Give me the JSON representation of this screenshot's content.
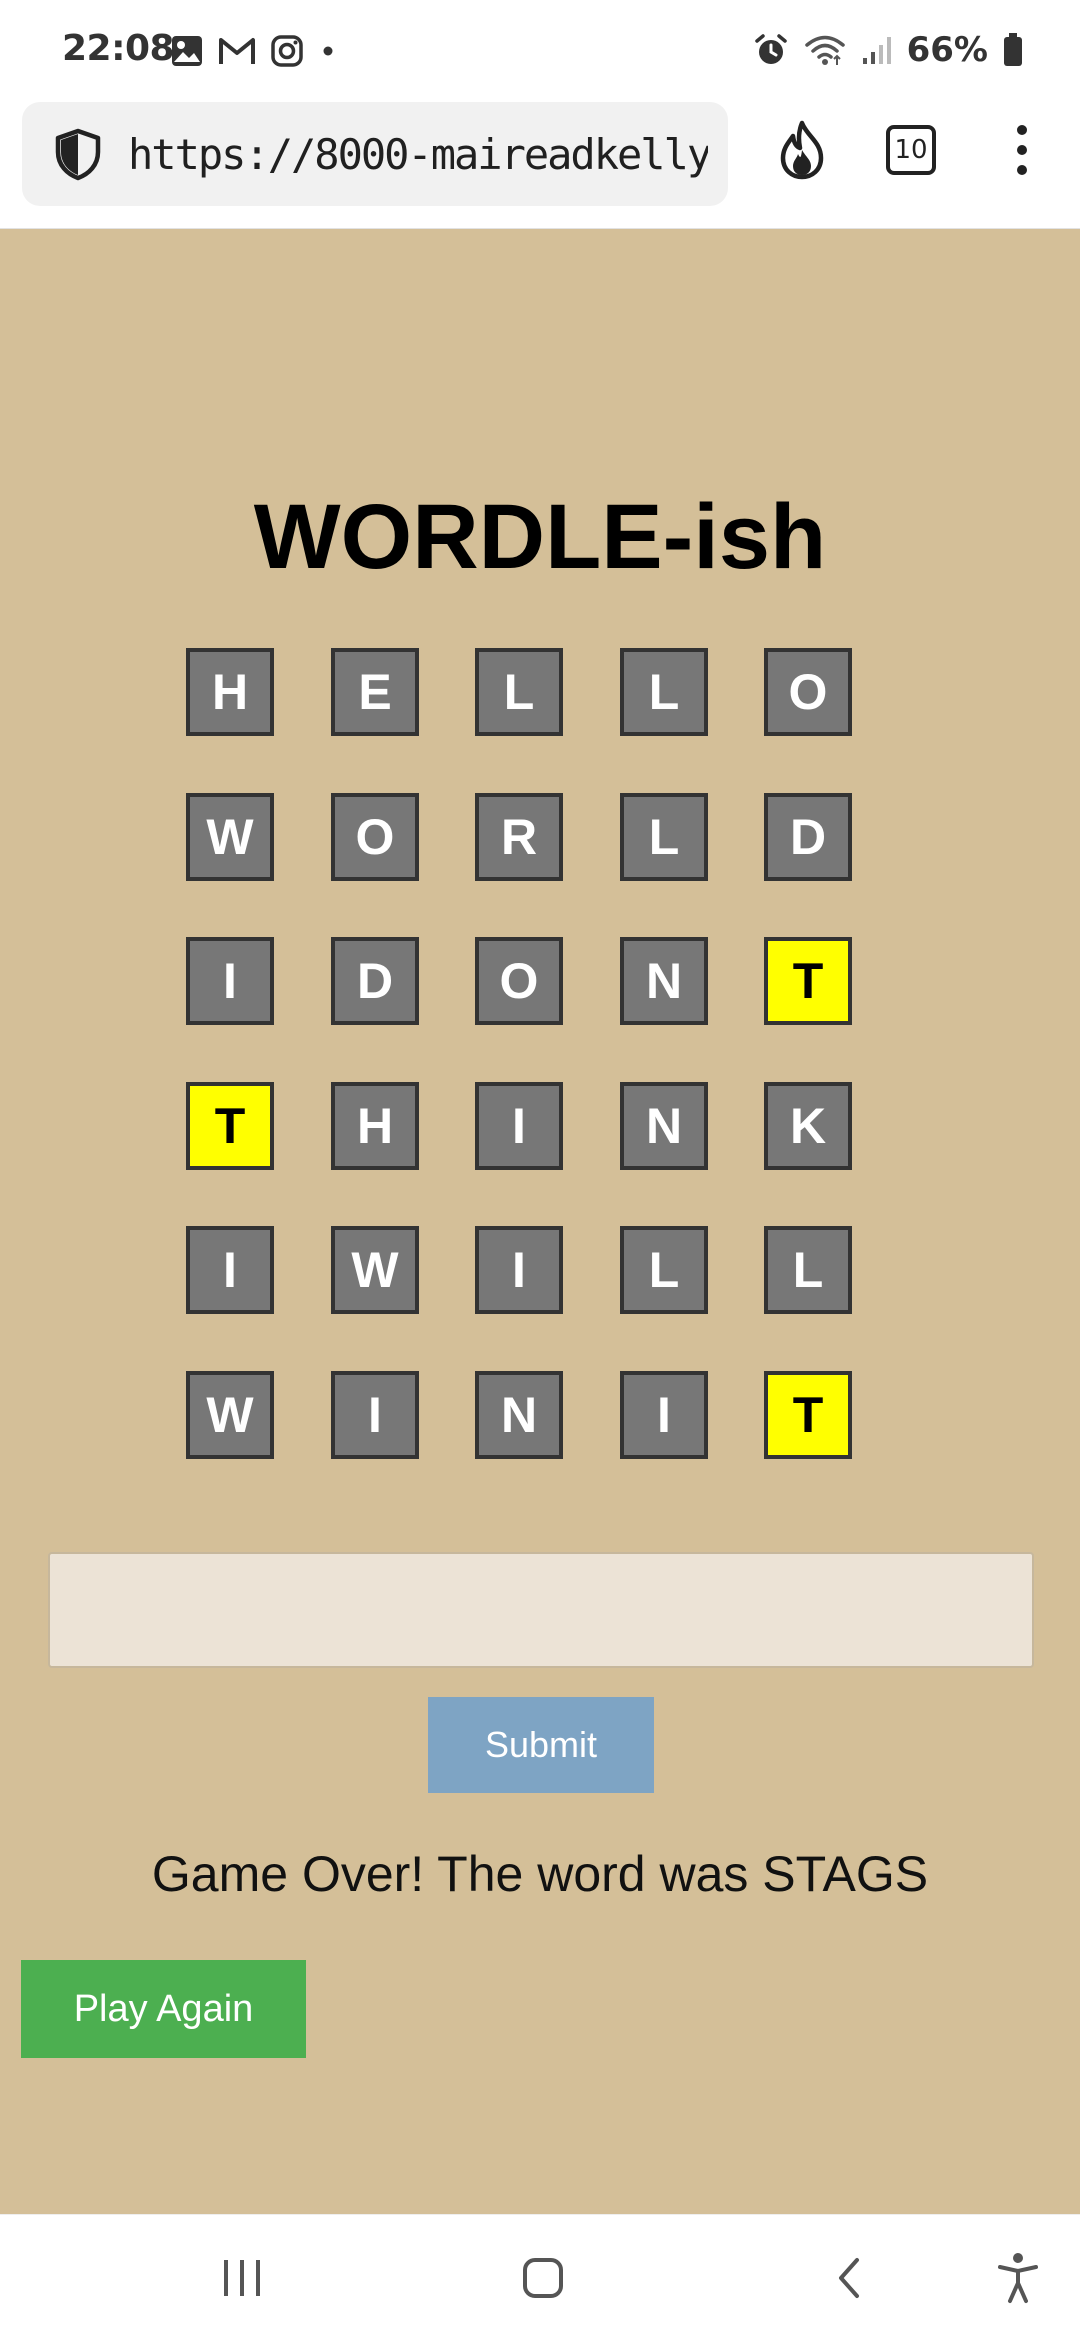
{
  "status_bar": {
    "time": "22:08",
    "battery": "66%",
    "left_icons": [
      "gallery-icon",
      "gmail-icon",
      "instagram-icon",
      "dot-icon"
    ],
    "right_icons": [
      "alarm-icon",
      "wifi-icon",
      "signal-icon",
      "battery-icon"
    ]
  },
  "browser": {
    "url": "https://8000-maireadkelly-",
    "tab_count": "10",
    "icons": [
      "shield-icon",
      "flame-icon",
      "tabs-icon",
      "more-vert-icon"
    ]
  },
  "game": {
    "title": "WORDLE-ish",
    "rows": [
      [
        {
          "letter": "H",
          "state": "absent"
        },
        {
          "letter": "E",
          "state": "absent"
        },
        {
          "letter": "L",
          "state": "absent"
        },
        {
          "letter": "L",
          "state": "absent"
        },
        {
          "letter": "O",
          "state": "absent"
        }
      ],
      [
        {
          "letter": "W",
          "state": "absent"
        },
        {
          "letter": "O",
          "state": "absent"
        },
        {
          "letter": "R",
          "state": "absent"
        },
        {
          "letter": "L",
          "state": "absent"
        },
        {
          "letter": "D",
          "state": "absent"
        }
      ],
      [
        {
          "letter": "I",
          "state": "absent"
        },
        {
          "letter": "D",
          "state": "absent"
        },
        {
          "letter": "O",
          "state": "absent"
        },
        {
          "letter": "N",
          "state": "absent"
        },
        {
          "letter": "T",
          "state": "present"
        }
      ],
      [
        {
          "letter": "T",
          "state": "present"
        },
        {
          "letter": "H",
          "state": "absent"
        },
        {
          "letter": "I",
          "state": "absent"
        },
        {
          "letter": "N",
          "state": "absent"
        },
        {
          "letter": "K",
          "state": "absent"
        }
      ],
      [
        {
          "letter": "I",
          "state": "absent"
        },
        {
          "letter": "W",
          "state": "absent"
        },
        {
          "letter": "I",
          "state": "absent"
        },
        {
          "letter": "L",
          "state": "absent"
        },
        {
          "letter": "L",
          "state": "absent"
        }
      ],
      [
        {
          "letter": "W",
          "state": "absent"
        },
        {
          "letter": "I",
          "state": "absent"
        },
        {
          "letter": "N",
          "state": "absent"
        },
        {
          "letter": "I",
          "state": "absent"
        },
        {
          "letter": "T",
          "state": "present"
        }
      ]
    ],
    "colors": {
      "absent": "#777777",
      "present": "#ffff00",
      "background": "#d4bf98"
    },
    "input_value": "",
    "submit_label": "Submit",
    "message": "Game Over! The word was STAGS",
    "play_again_label": "Play Again"
  },
  "nav_bar": {
    "icons": [
      "recent-apps-icon",
      "home-icon",
      "back-icon",
      "accessibility-icon"
    ]
  }
}
